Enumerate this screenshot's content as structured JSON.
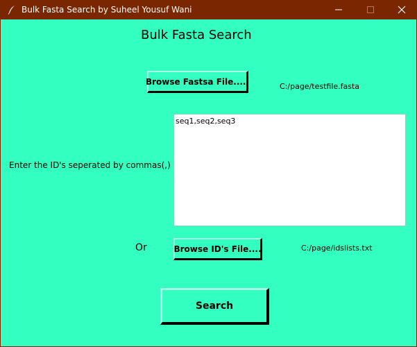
{
  "window": {
    "title": "Bulk Fasta Search by Suheel Yousuf Wani",
    "minimize_label": "Minimize",
    "maximize_label": "Maximize",
    "close_label": "Close"
  },
  "main": {
    "heading": "Bulk Fasta Search",
    "browse_fasta_label": "Browse Fastsa File.....",
    "fasta_path": "C:/page/testfile.fasta",
    "ids_prompt": "Enter the ID's seperated by commas(,)",
    "ids_value": "seq1,seq2,seq3",
    "or_label": "Or",
    "browse_ids_label": "Browse ID's File....",
    "ids_path": "C:/page/idslists.txt",
    "search_label": "Search"
  },
  "colors": {
    "background": "#32ffc0",
    "titlebar": "#7a2600",
    "titlebar_text": "#ffffff",
    "textarea_background": "#ffffff"
  },
  "icons": {
    "app": "feather-pen-icon",
    "minimize": "minimize-icon",
    "maximize": "maximize-icon",
    "close": "close-icon"
  }
}
